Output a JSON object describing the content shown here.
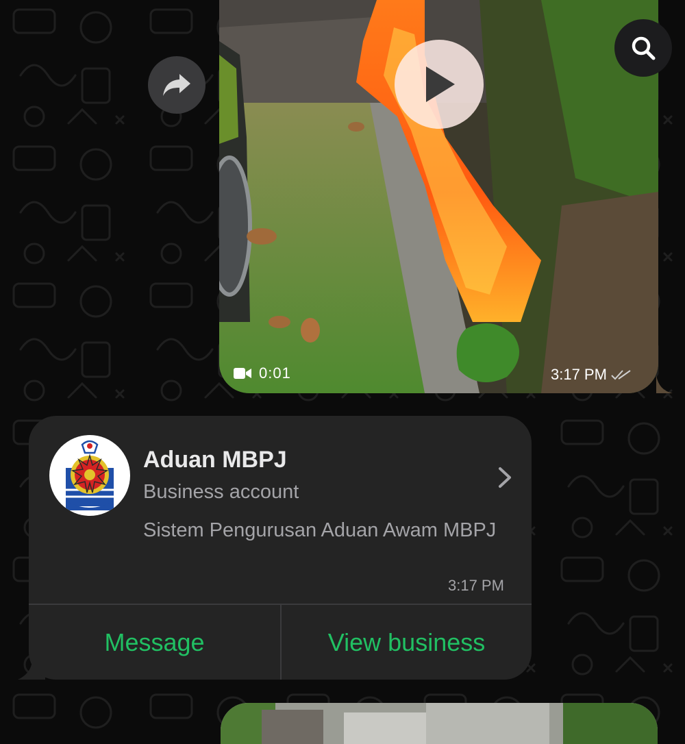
{
  "chat": {
    "video_message": {
      "duration": "0:01",
      "time": "3:17 PM",
      "status_icon": "double-check-icon"
    },
    "contact_card": {
      "name": "Aduan MBPJ",
      "account_type": "Business account",
      "description": "Sistem Pengurusan Aduan Awam MBPJ",
      "time": "3:17 PM",
      "actions": {
        "message_label": "Message",
        "view_business_label": "View business"
      }
    }
  },
  "icons": {
    "forward": "forward-arrow-icon",
    "search": "search-icon",
    "play": "play-icon",
    "video": "video-camera-icon",
    "chevron": "chevron-right-icon"
  },
  "colors": {
    "background": "#0b0b0b",
    "card": "#242424",
    "accent_green": "#21c063",
    "primary_text": "#e9e9ea",
    "secondary_text": "#a4a4a8"
  }
}
